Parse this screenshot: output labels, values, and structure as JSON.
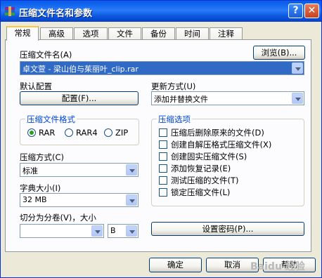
{
  "window": {
    "title": "压缩文件名和参数",
    "help_glyph": "?",
    "close_glyph": "✕"
  },
  "tabs": [
    "常规",
    "高级",
    "选项",
    "文件",
    "备份",
    "时间",
    "注释"
  ],
  "archive": {
    "label": "压缩文件名(A)",
    "value": "卓文萱 - 梁山伯与茱丽叶_clip.rar",
    "browse_label": "浏览(B)..."
  },
  "profile": {
    "label": "默认配置",
    "button_label": "配置(F)..."
  },
  "update": {
    "label": "更新方式(U)",
    "value": "添加并替换文件"
  },
  "format": {
    "label": "压缩文件格式",
    "options": [
      "RAR",
      "RAR4",
      "ZIP"
    ],
    "selected": "RAR"
  },
  "method": {
    "label": "压缩方式(C)",
    "value": "标准"
  },
  "dictionary": {
    "label": "字典大小(I)",
    "value": "32 MB"
  },
  "split": {
    "label": "切分为分卷(V)，大小",
    "value": "",
    "unit": "B"
  },
  "options": {
    "label": "压缩选项",
    "items": [
      {
        "label": "压缩后删除原来的文件(D)",
        "checked": false
      },
      {
        "label": "创建自解压格式压缩文件(X)",
        "checked": false
      },
      {
        "label": "创建固实压缩文件(S)",
        "checked": false
      },
      {
        "label": "添加恢复记录(E)",
        "checked": false
      },
      {
        "label": "测试压缩的文件(T)",
        "checked": false
      },
      {
        "label": "锁定压缩文件(L)",
        "checked": false
      }
    ]
  },
  "password_button": "设置密码(P)...",
  "footer": {
    "ok": "确定",
    "cancel": "取消",
    "help": "帮助"
  },
  "watermark": "Baidu 经验"
}
